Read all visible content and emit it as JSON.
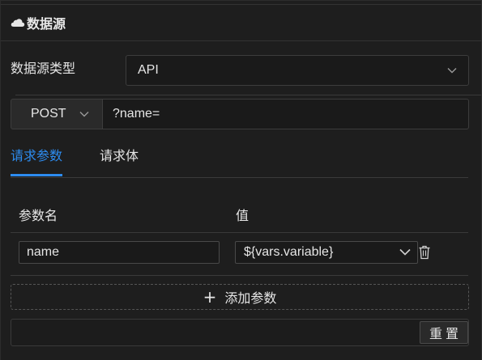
{
  "header": {
    "icon": "cloud-icon",
    "title": "数据源"
  },
  "datasource": {
    "type_label": "数据源类型",
    "type_value": "API"
  },
  "request": {
    "method": "POST",
    "url": "?name="
  },
  "tabs": [
    {
      "label": "请求参数",
      "active": true
    },
    {
      "label": "请求体",
      "active": false
    }
  ],
  "params": {
    "columns": [
      "参数名",
      "值"
    ],
    "rows": [
      {
        "name": "name",
        "value": "${vars.variable}"
      }
    ],
    "add_label": "添加参数"
  },
  "footer": {
    "reset_label": "重置"
  },
  "colors": {
    "accent": "#2d8cf0",
    "background": "#1e1e1e"
  }
}
